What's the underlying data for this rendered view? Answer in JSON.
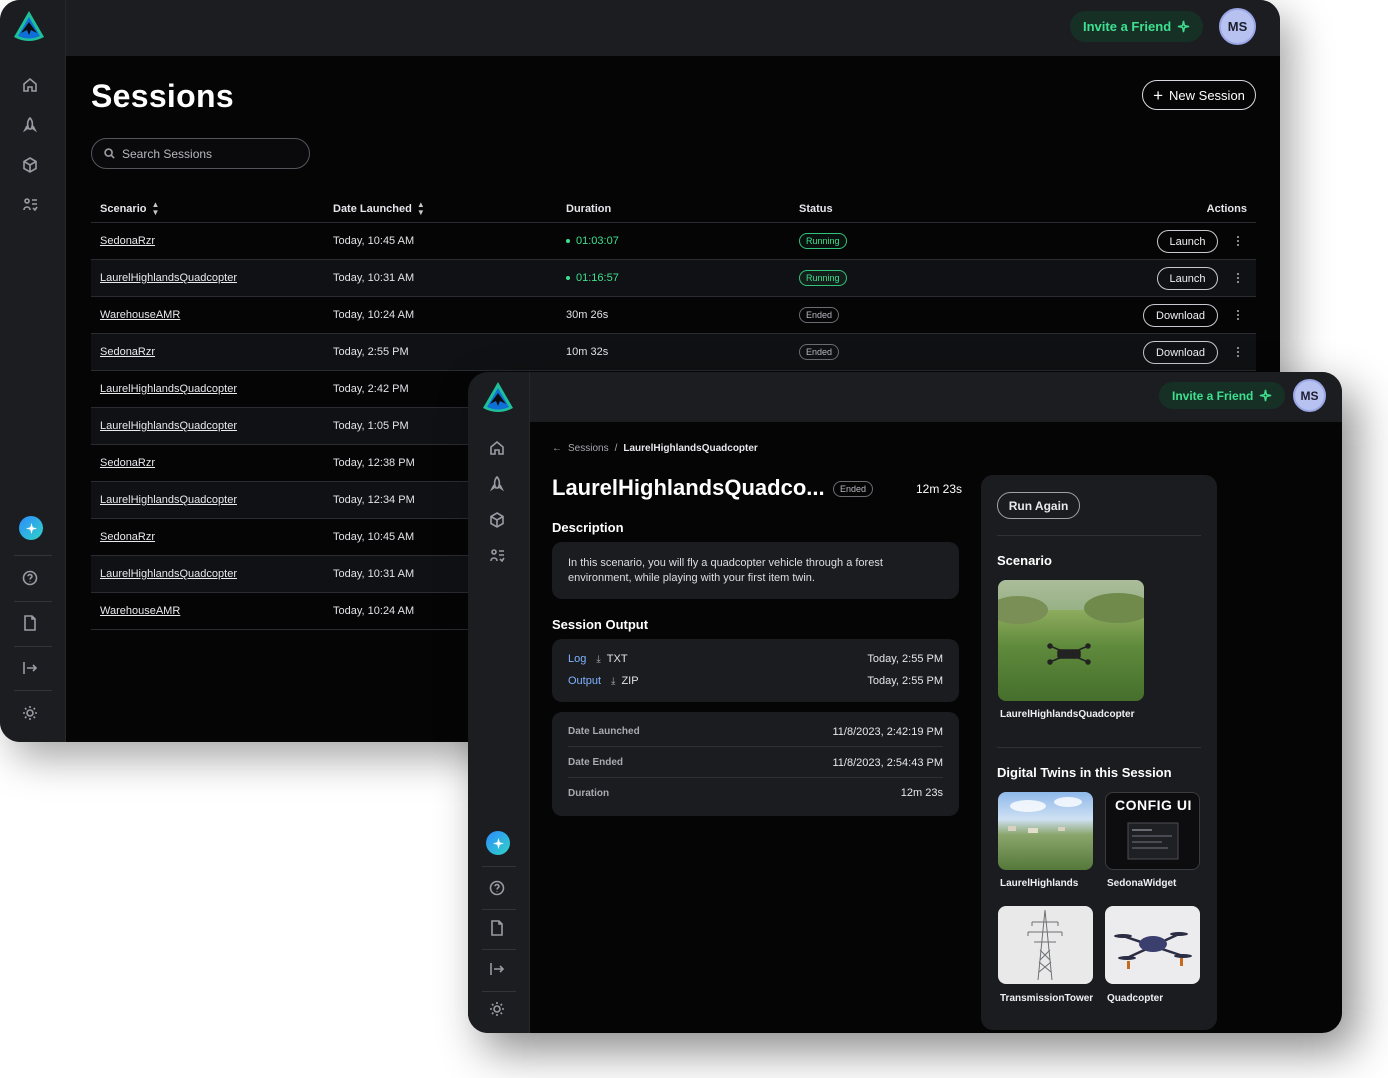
{
  "colors": {
    "accent_green": "#3ee08f",
    "sidebar_bg": "#1c1d21",
    "page_bg": "#050506",
    "link_blue": "#7fb3ff"
  },
  "icons": [
    "logo-icon",
    "home-icon",
    "rocket-icon",
    "cube-icon",
    "sessions-icon",
    "ai-sparkle-icon",
    "help-icon",
    "document-icon",
    "logout-icon",
    "theme-icon",
    "search-icon",
    "sort-icon",
    "plus-icon",
    "kebab-icon",
    "download-icon",
    "back-arrow-icon",
    "sparkle-icon"
  ],
  "header": {
    "invite_label": "Invite a Friend",
    "avatar_initials": "MS"
  },
  "sessions_page": {
    "title": "Sessions",
    "new_session_label": "New Session",
    "search_placeholder": "Search Sessions",
    "columns": {
      "scenario": "Scenario",
      "date": "Date Launched",
      "duration": "Duration",
      "status": "Status",
      "actions": "Actions"
    },
    "rows": [
      {
        "scenario": "SedonaRzr",
        "date": "Today, 10:45 AM",
        "duration": "01:03:07",
        "status": "Running",
        "action": "Launch"
      },
      {
        "scenario": "LaurelHighlandsQuadcopter",
        "date": "Today, 10:31 AM",
        "duration": "01:16:57",
        "status": "Running",
        "action": "Launch"
      },
      {
        "scenario": "WarehouseAMR",
        "date": "Today, 10:24 AM",
        "duration": "30m 26s",
        "status": "Ended",
        "action": "Download"
      },
      {
        "scenario": "SedonaRzr",
        "date": "Today, 2:55 PM",
        "duration": "10m 32s",
        "status": "Ended",
        "action": "Download"
      },
      {
        "scenario": "LaurelHighlandsQuadcopter",
        "date": "Today, 2:42 PM"
      },
      {
        "scenario": "LaurelHighlandsQuadcopter",
        "date": "Today, 1:05 PM"
      },
      {
        "scenario": "SedonaRzr",
        "date": "Today, 12:38 PM"
      },
      {
        "scenario": "LaurelHighlandsQuadcopter",
        "date": "Today, 12:34 PM"
      },
      {
        "scenario": "SedonaRzr",
        "date": "Today, 10:45 AM"
      },
      {
        "scenario": "LaurelHighlandsQuadcopter",
        "date": "Today, 10:31 AM"
      },
      {
        "scenario": "WarehouseAMR",
        "date": "Today, 10:24 AM"
      }
    ]
  },
  "detail": {
    "breadcrumb_parent": "Sessions",
    "breadcrumb_sep": "/",
    "breadcrumb_current": "LaurelHighlandsQuadcopter",
    "title": "LaurelHighlandsQuadco...",
    "status": "Ended",
    "duration": "12m 23s",
    "description_heading": "Description",
    "description": "In this scenario, you will fly a quadcopter vehicle through a forest environment, while playing with your first item twin.",
    "output_heading": "Session Output",
    "outputs": [
      {
        "name": "Log",
        "ext": "TXT",
        "time": "Today, 2:55 PM"
      },
      {
        "name": "Output",
        "ext": "ZIP",
        "time": "Today, 2:55 PM"
      }
    ],
    "meta": [
      {
        "key": "Date Launched",
        "value": "11/8/2023, 2:42:19 PM"
      },
      {
        "key": "Date Ended",
        "value": "11/8/2023, 2:54:43 PM"
      },
      {
        "key": "Duration",
        "value": "12m 23s"
      }
    ],
    "run_again_label": "Run Again",
    "scenario_heading": "Scenario",
    "scenario_name": "LaurelHighlandsQuadcopter",
    "twins_heading": "Digital Twins in this Session",
    "twins": [
      {
        "name": "LaurelHighlands"
      },
      {
        "name": "SedonaWidget",
        "thumb_text": "CONFIG UI"
      },
      {
        "name": "TransmissionTower"
      },
      {
        "name": "Quadcopter"
      }
    ]
  }
}
